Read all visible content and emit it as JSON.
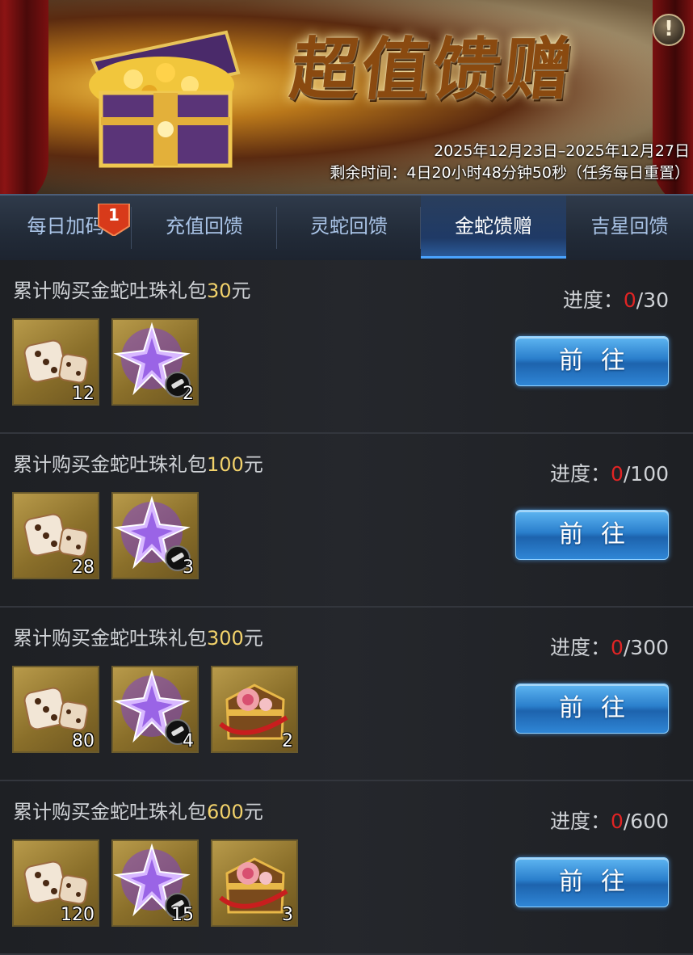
{
  "banner": {
    "title": "超值馈赠",
    "date_range": "2025年12月23日–2025年12月27日",
    "remaining": "剩余时间：4日20小时48分钟50秒（任务每日重置）",
    "info_label": "!"
  },
  "tabs": [
    {
      "label": "每日加码",
      "active": false
    },
    {
      "label": "充值回馈",
      "active": false
    },
    {
      "label": "灵蛇回馈",
      "active": false
    },
    {
      "label": "金蛇馈赠",
      "active": true
    },
    {
      "label": "吉星回馈",
      "active": false
    }
  ],
  "tab_badge": "1",
  "rows": [
    {
      "title_prefix": "累计购买金蛇吐珠礼包",
      "amount": "30",
      "unit": "元",
      "progress_label": "进度：",
      "progress_current": "0",
      "progress_target": "/30",
      "button": "前往",
      "items": [
        {
          "icon": "dice-icon",
          "qty": "12"
        },
        {
          "icon": "purple-star-crystal-icon",
          "qty": "2"
        }
      ]
    },
    {
      "title_prefix": "累计购买金蛇吐珠礼包",
      "amount": "100",
      "unit": "元",
      "progress_label": "进度：",
      "progress_current": "0",
      "progress_target": "/100",
      "button": "前往",
      "items": [
        {
          "icon": "dice-icon",
          "qty": "28"
        },
        {
          "icon": "purple-star-crystal-icon",
          "qty": "3"
        }
      ]
    },
    {
      "title_prefix": "累计购买金蛇吐珠礼包",
      "amount": "300",
      "unit": "元",
      "progress_label": "进度：",
      "progress_current": "0",
      "progress_target": "/300",
      "button": "前往",
      "items": [
        {
          "icon": "dice-icon",
          "qty": "80"
        },
        {
          "icon": "purple-star-crystal-icon",
          "qty": "4"
        },
        {
          "icon": "flower-treasure-chest-icon",
          "qty": "2"
        }
      ]
    },
    {
      "title_prefix": "累计购买金蛇吐珠礼包",
      "amount": "600",
      "unit": "元",
      "progress_label": "进度：",
      "progress_current": "0",
      "progress_target": "/600",
      "button": "前往",
      "items": [
        {
          "icon": "dice-icon",
          "qty": "120"
        },
        {
          "icon": "purple-star-crystal-icon",
          "qty": "15"
        },
        {
          "icon": "flower-treasure-chest-icon",
          "qty": "3"
        }
      ]
    }
  ],
  "colors": {
    "accent_gold": "#f2d26b",
    "progress_red": "#e02424",
    "button_blue": "#2a7fcc",
    "tab_active_underline": "#4aa3ff"
  }
}
